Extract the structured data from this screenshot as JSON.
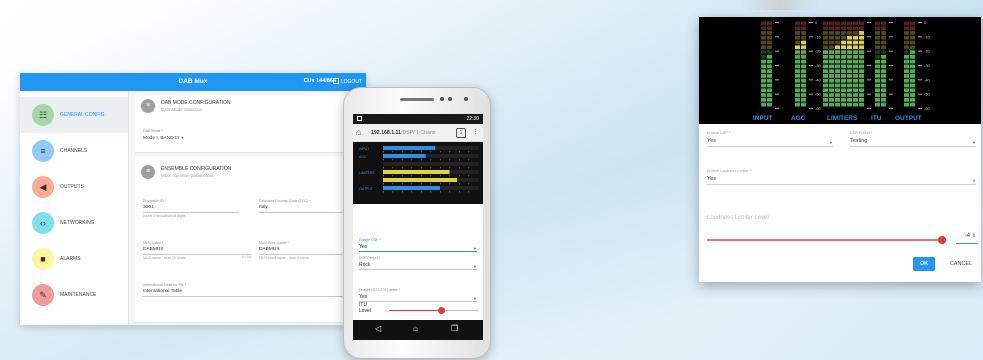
{
  "desktop": {
    "title": "DAB Mux",
    "user": "CUs 144/864",
    "logout": "LOGOUT",
    "nav": [
      {
        "label": "GENERAL CONFIG",
        "icon": "sliders-icon",
        "glyph": "☷",
        "color": "#a5d6a7",
        "active": true
      },
      {
        "label": "CHANNELS",
        "icon": "playlist-icon",
        "glyph": "≡",
        "color": "#90caf9",
        "active": false
      },
      {
        "label": "OUTPUTS",
        "icon": "speaker-icon",
        "glyph": "◀",
        "color": "#ffab91",
        "active": false
      },
      {
        "label": "NETWORKING",
        "icon": "network-icon",
        "glyph": "‹›",
        "color": "#80deea",
        "active": false
      },
      {
        "label": "ALARMS",
        "icon": "alarm-icon",
        "glyph": "■",
        "color": "#fff59d",
        "active": false
      },
      {
        "label": "MAINTENANCE",
        "icon": "wrench-icon",
        "glyph": "✎",
        "color": "#ef9a9a",
        "active": false
      }
    ],
    "mode_card": {
      "title": "DAB MODE CONFIGURATION",
      "subtitle": "DAB Mode Selection",
      "field_label": "DAB Mode *",
      "field_value": "Mode I, BAND III"
    },
    "ensemble_card": {
      "title": "ENSEMBLE CONFIGURATION",
      "subtitle": "MUX common parameters",
      "ensemble_id_label": "Ensemble ID *",
      "ensemble_id_value": "3001",
      "ensemble_id_hint": "Insert 4 hexadecimal digits",
      "country_label": "Extended Country Code (ECC) *",
      "country_value": "Italy",
      "mux_label": "MUX Label *",
      "mux_value": "DABMUX",
      "mux_hint": "MUX name - max 16 chars",
      "mux_count": "6 / 16",
      "short_label": "MUX Short Label *",
      "short_value": "DABMUX",
      "short_hint": "MUX short name - max 8 chars",
      "table_label": "International Table for PIL *",
      "table_value": "International Table"
    }
  },
  "phone": {
    "time": "22:30",
    "url": "192.168.1.11",
    "url_rest": "/DSP/ 1 Chans",
    "tab_count": "1",
    "enable_dsp_label": "Enable DSP *",
    "enable_dsp_value": "Yes",
    "dsp_preset_label": "DSP Preset *",
    "dsp_preset_value": "Rock",
    "itu_limiter_label": "Enable ITU 1770 Limiter *",
    "itu_limiter_value": "Yes",
    "itu_level_label": "ITU Level",
    "itu_level": 0.58,
    "meter_labels": [
      "INPUT",
      "AGC",
      "LIMITERS",
      "OUTPUT"
    ]
  },
  "dialog": {
    "meter_labels": [
      "INPUT",
      "AGC",
      "LIMITERS",
      "ITU",
      "OUTPUT"
    ],
    "scale": [
      "0",
      "-10",
      "-20",
      "-30",
      "-40",
      "-50",
      "-60"
    ],
    "enable_dsp_label": "Enable DSP *",
    "enable_dsp_value": "Yes",
    "dsp_preset_label": "DSP Preset *",
    "dsp_preset_value": "Testing",
    "loudness_label": "Enable Loudness Limiter *",
    "loudness_value": "Yes",
    "limiter_level_label": "Loudness Limiter Level",
    "limiter_level_value": "-4",
    "limiter_level": 0.98,
    "ok": "OK",
    "cancel": "CANCEL"
  }
}
